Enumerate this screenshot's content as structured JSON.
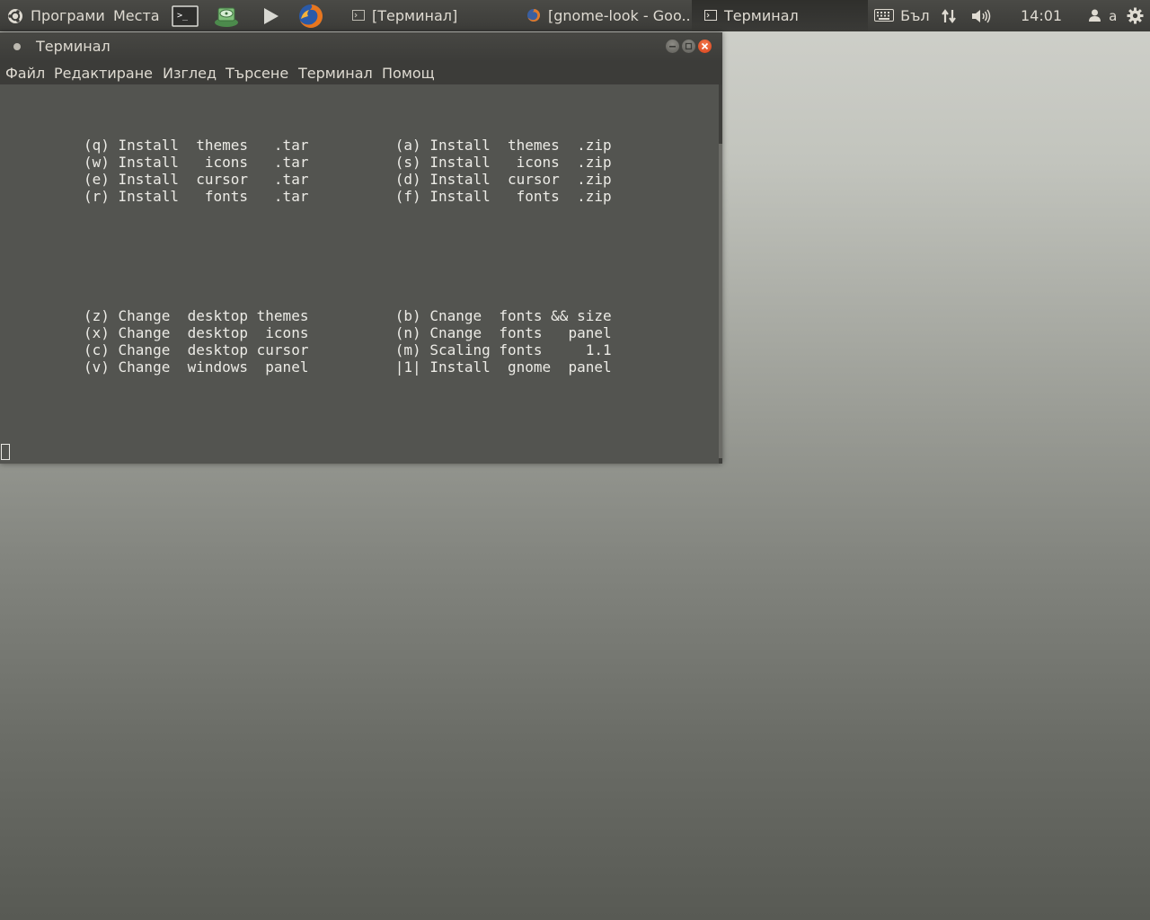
{
  "panel": {
    "menu_applications": "Програми",
    "menu_places": "Места",
    "launchers": [
      "terminal-icon",
      "disk-utility-icon",
      "media-player-icon",
      "firefox-icon"
    ],
    "tasks": [
      {
        "label": "[Терминал]",
        "icon": "terminal-icon",
        "active": false
      },
      {
        "label": "[gnome-look - Goo...",
        "icon": "firefox-icon",
        "active": false
      },
      {
        "label": "Терминал",
        "icon": "terminal-icon",
        "active": true
      }
    ],
    "keyboard_layout": "Бъл",
    "clock": "14:01",
    "user": "a"
  },
  "window": {
    "title": "Терминал",
    "menu": [
      "Файл",
      "Редактиране",
      "Изглед",
      "Търсене",
      "Терминал",
      "Помощ"
    ]
  },
  "terminal": {
    "lines": [
      "(q) Install  themes   .tar          (a) Install  themes  .zip",
      "(w) Install   icons   .tar          (s) Install   icons  .zip",
      "(e) Install  cursor   .tar          (d) Install  cursor  .zip",
      "(r) Install   fonts   .tar          (f) Install   fonts  .zip",
      "(z) Change  desktop themes          (b) Cnange  fonts && size",
      "(x) Change  desktop  icons          (n) Cnange  fonts   panel",
      "(c) Change  desktop cursor          (m) Scaling fonts     1.1",
      "(v) Change  windows  panel          |1| Install  gnome  panel"
    ]
  },
  "colors": {
    "panel_bg": "#3b3b38",
    "terminal_bg": "#535450",
    "terminal_fg": "#ecebe6",
    "close_button": "#df4a1f"
  }
}
